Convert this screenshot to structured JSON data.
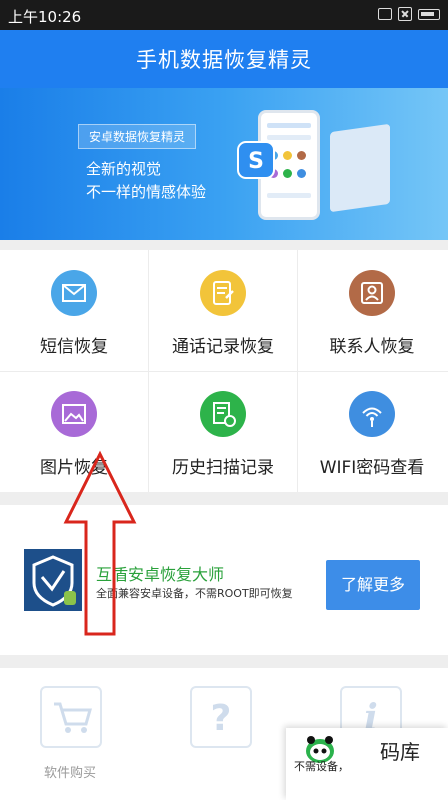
{
  "status_bar": {
    "time": "上午10:26"
  },
  "header": {
    "title": "手机数据恢复精灵"
  },
  "banner": {
    "tag": "安卓数据恢复精灵",
    "line1": "全新的视觉",
    "line2": "不一样的情感体验",
    "pager": {
      "count": 3,
      "active_index": 2
    }
  },
  "features": [
    {
      "label": "短信恢复",
      "icon": "envelope-icon",
      "color": "#4aa6e8"
    },
    {
      "label": "通话记录恢复",
      "icon": "call-log-icon",
      "color": "#f2c43a"
    },
    {
      "label": "联系人恢复",
      "icon": "contact-card-icon",
      "color": "#b26a47"
    },
    {
      "label": "图片恢复",
      "icon": "picture-icon",
      "color": "#a86ad7"
    },
    {
      "label": "历史扫描记录",
      "icon": "scan-history-icon",
      "color": "#2db34a"
    },
    {
      "label": "WIFI密码查看",
      "icon": "wifi-key-icon",
      "color": "#3f8ee0"
    }
  ],
  "promo": {
    "title": "互盾安卓恢复大师",
    "subtitle": "全面兼容安卓设备，不需ROOT即可恢复",
    "button": "了解更多"
  },
  "bottom_nav": [
    {
      "label": "软件购买",
      "icon": "shopping-cart-icon"
    },
    {
      "label": "",
      "icon": "question-icon"
    },
    {
      "label": "",
      "icon": "info-icon"
    }
  ],
  "overlay": {
    "code": "码库",
    "text": "不需设备，"
  }
}
